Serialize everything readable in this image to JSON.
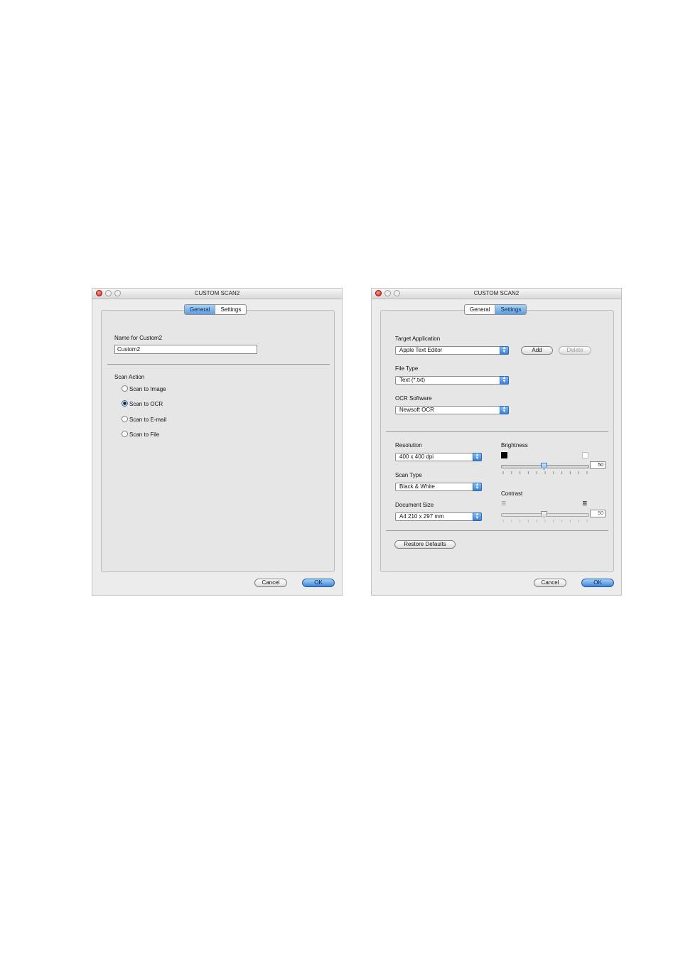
{
  "general_window": {
    "title": "CUSTOM SCAN2",
    "tabs": [
      {
        "label": "General",
        "active": true
      },
      {
        "label": "Settings",
        "active": false
      }
    ],
    "name_label": "Name for Custom2",
    "name_value": "Custom2",
    "scan_action_label": "Scan Action",
    "options": [
      {
        "label": "Scan to Image",
        "selected": false
      },
      {
        "label": "Scan to OCR",
        "selected": true
      },
      {
        "label": "Scan to E-mail",
        "selected": false
      },
      {
        "label": "Scan to File",
        "selected": false
      }
    ],
    "cancel_label": "Cancel",
    "ok_label": "OK"
  },
  "settings_window": {
    "title": "CUSTOM SCAN2",
    "tabs": [
      {
        "label": "General",
        "active": false
      },
      {
        "label": "Settings",
        "active": true
      }
    ],
    "target_app_label": "Target Application",
    "target_app_value": "Apple Text Editor",
    "add_label": "Add",
    "delete_label": "Delete",
    "file_type_label": "File Type",
    "file_type_value": "Text (*.txt)",
    "ocr_label": "OCR Software",
    "ocr_value": "Newsoft OCR",
    "resolution_label": "Resolution",
    "resolution_value": "400 x 400 dpi",
    "scan_type_label": "Scan Type",
    "scan_type_value": "Black & White",
    "doc_size_label": "Document Size",
    "doc_size_value": "A4 210 x 297 mm",
    "brightness_label": "Brightness",
    "brightness_value": "50",
    "contrast_label": "Contrast",
    "contrast_value": "50",
    "restore_label": "Restore Defaults",
    "cancel_label": "Cancel",
    "ok_label": "OK"
  },
  "colors": {
    "accent": "#5f9fe0",
    "close_button": "#d21b10"
  }
}
